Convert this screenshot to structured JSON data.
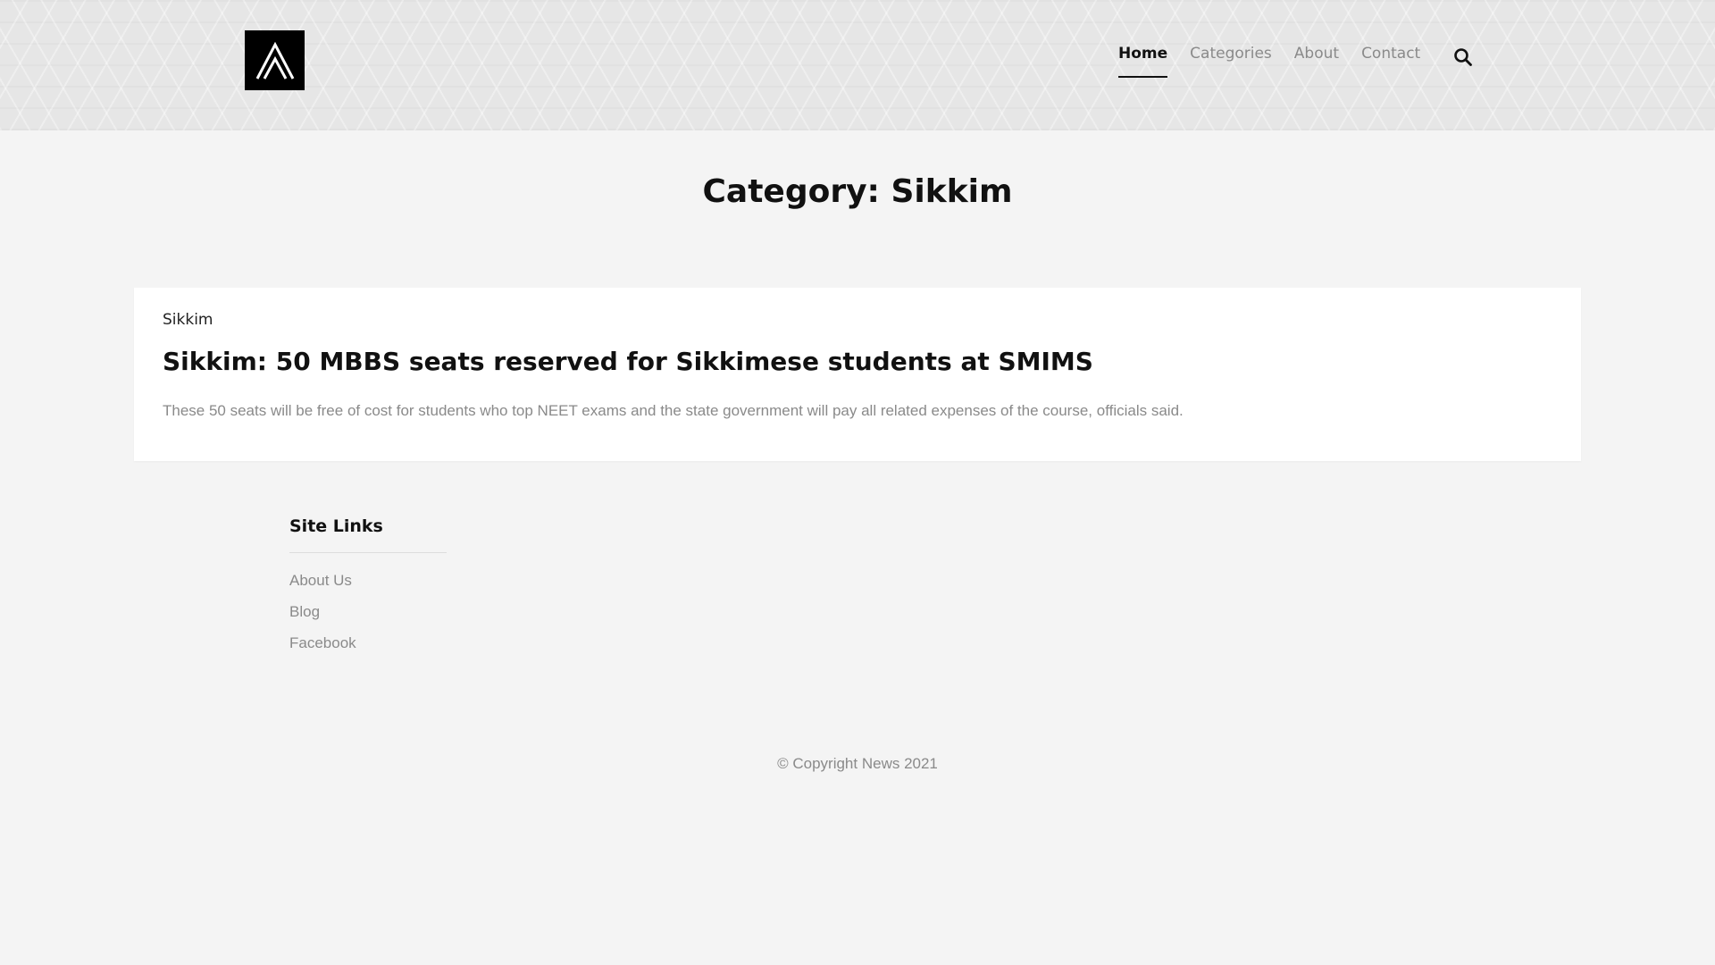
{
  "header": {
    "logo_alt": "Logo",
    "nav": [
      {
        "label": "Home",
        "active": true
      },
      {
        "label": "Categories",
        "active": false
      },
      {
        "label": "About",
        "active": false
      },
      {
        "label": "Contact",
        "active": false
      }
    ],
    "search_icon": "search-icon"
  },
  "page": {
    "title": "Category: Sikkim"
  },
  "posts": [
    {
      "category": "Sikkim",
      "title": "Sikkim: 50 MBBS seats reserved for Sikkimese students at SMIMS",
      "excerpt": "These 50 seats will be free of cost for students who top NEET exams and the state government will pay all related expenses of the course, officials said."
    }
  ],
  "footer": {
    "widget_title": "Site Links",
    "links": [
      "About Us",
      "Blog",
      "Facebook"
    ],
    "copyright": "© Copyright News 2021"
  },
  "colors": {
    "accent": "#111111",
    "muted_text": "#8a8a8a",
    "background": "#f4f4f4",
    "card": "#ffffff"
  }
}
